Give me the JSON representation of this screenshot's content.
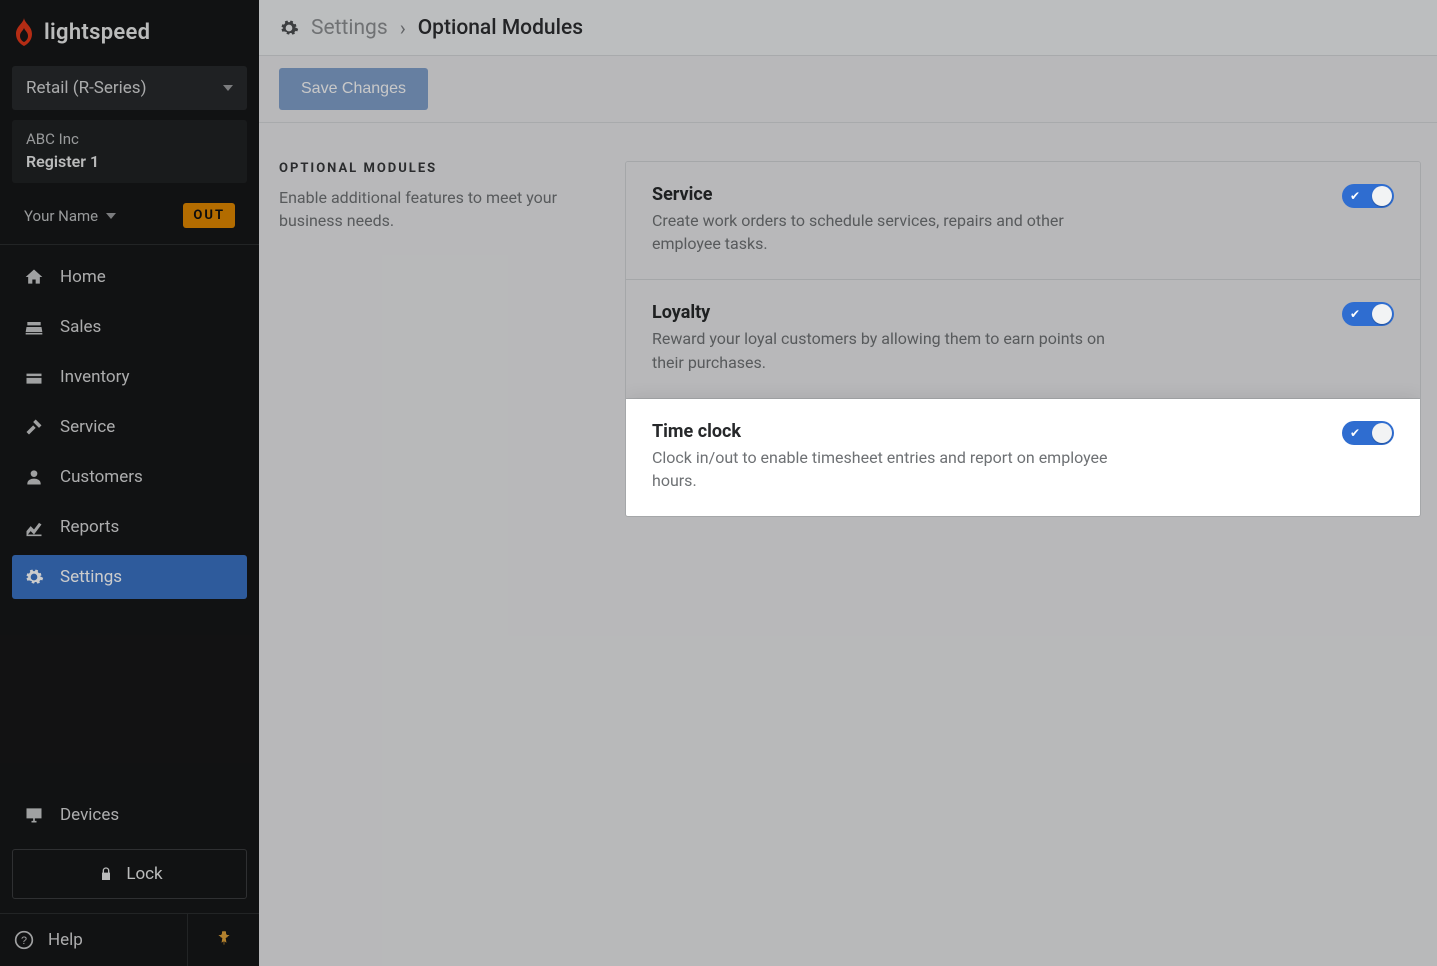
{
  "brand": {
    "name": "lightspeed"
  },
  "sidebar": {
    "product_label": "Retail (R-Series)",
    "company": "ABC Inc",
    "register": "Register 1",
    "user_name": "Your Name",
    "out_badge": "OUT",
    "nav": [
      {
        "label": "Home"
      },
      {
        "label": "Sales"
      },
      {
        "label": "Inventory"
      },
      {
        "label": "Service"
      },
      {
        "label": "Customers"
      },
      {
        "label": "Reports"
      },
      {
        "label": "Settings"
      }
    ],
    "devices_label": "Devices",
    "lock_label": "Lock",
    "help_label": "Help"
  },
  "breadcrumb": {
    "parent": "Settings",
    "current": "Optional Modules"
  },
  "actions": {
    "save_label": "Save Changes"
  },
  "section": {
    "title": "OPTIONAL MODULES",
    "desc": "Enable additional features to meet your business needs."
  },
  "modules": [
    {
      "title": "Service",
      "desc": "Create work orders to schedule services, repairs and other employee tasks.",
      "enabled": true
    },
    {
      "title": "Loyalty",
      "desc": "Reward your loyal customers by allowing them to earn points on their purchases.",
      "enabled": true
    },
    {
      "title": "Time clock",
      "desc": "Clock in/out to enable timesheet entries and report on employee hours.",
      "enabled": true
    }
  ]
}
